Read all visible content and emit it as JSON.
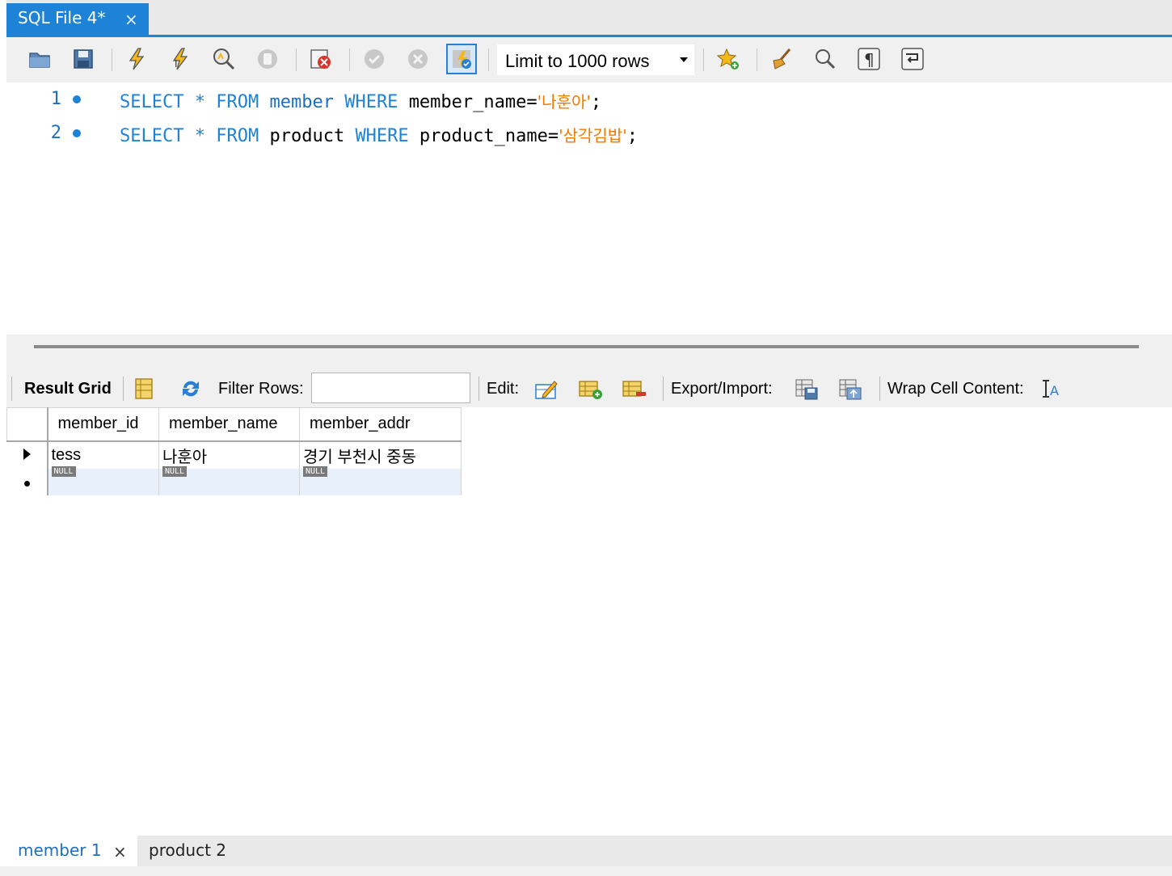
{
  "file_tab": {
    "title": "SQL File 4*",
    "close": "×"
  },
  "toolbar": {
    "icons": [
      "open-folder-icon",
      "save-icon",
      "execute-icon",
      "execute-current-icon",
      "explain-icon",
      "stop-icon",
      "stop-on-error-icon",
      "commit-icon",
      "rollback-icon",
      "autocommit-icon",
      "add-snippet-icon",
      "beautify-icon",
      "find-icon",
      "invisible-chars-icon",
      "word-wrap-icon"
    ],
    "limit_label": "Limit to 1000 rows"
  },
  "editor": {
    "lines": [
      {
        "no": "1",
        "kw1": "SELECT",
        "star": "*",
        "kw2": "FROM",
        "table": "member",
        "kw3": "WHERE",
        "col": "member_name=",
        "value": "'나훈아'",
        "end": ";"
      },
      {
        "no": "2",
        "kw1": "SELECT",
        "star": "*",
        "kw2": "FROM",
        "table": "product",
        "kw3": "WHERE",
        "col": "product_name=",
        "value": "'삼각김밥'",
        "end": ";"
      }
    ]
  },
  "result_toolbar": {
    "result_grid": "Result Grid",
    "filter_rows": "Filter Rows:",
    "edit": "Edit:",
    "export_import": "Export/Import:",
    "wrap": "Wrap Cell Content:"
  },
  "grid": {
    "columns": [
      "member_id",
      "member_name",
      "member_addr"
    ],
    "rows": [
      [
        "tess",
        "나훈아",
        "경기 부천시 중동"
      ]
    ],
    "new_row": [
      "NULL",
      "NULL",
      "NULL"
    ]
  },
  "result_tabs": {
    "active": "member 1",
    "close": "×",
    "other": "product 2"
  },
  "colors": {
    "accent": "#1e83d6",
    "keyword": "#1e83d6",
    "string": "#f27a00"
  }
}
